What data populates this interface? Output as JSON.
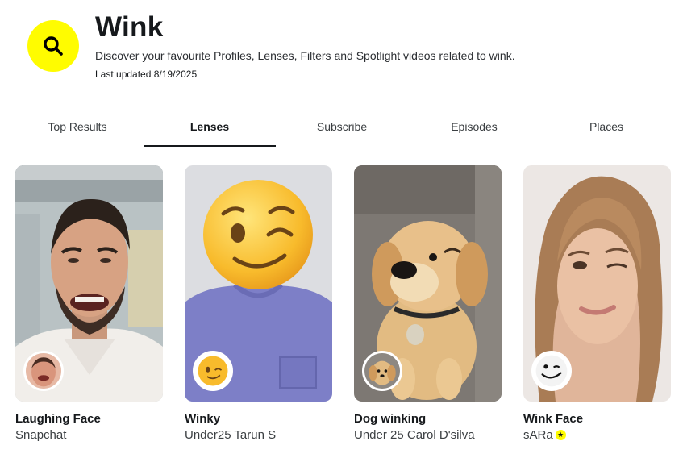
{
  "header": {
    "title": "Wink",
    "subtitle": "Discover your favourite Profiles, Lenses, Filters and Spotlight videos related to wink.",
    "updated": "Last updated 8/19/2025",
    "icon": "search-icon",
    "accent_color": "#FFFC00"
  },
  "tabs": [
    {
      "label": "Top Results",
      "active": false
    },
    {
      "label": "Lenses",
      "active": true
    },
    {
      "label": "Subscribe",
      "active": false
    },
    {
      "label": "Episodes",
      "active": false
    },
    {
      "label": "Places",
      "active": false
    }
  ],
  "cards": [
    {
      "name": "Laughing Face",
      "author": "Snapchat",
      "verified": false
    },
    {
      "name": "Winky",
      "author": "Under25 Tarun S",
      "verified": false
    },
    {
      "name": "Dog winking",
      "author": "Under 25 Carol D'silva",
      "verified": false
    },
    {
      "name": "Wink Face",
      "author": "sARa",
      "verified": true,
      "badge_icon": "star-icon"
    }
  ]
}
